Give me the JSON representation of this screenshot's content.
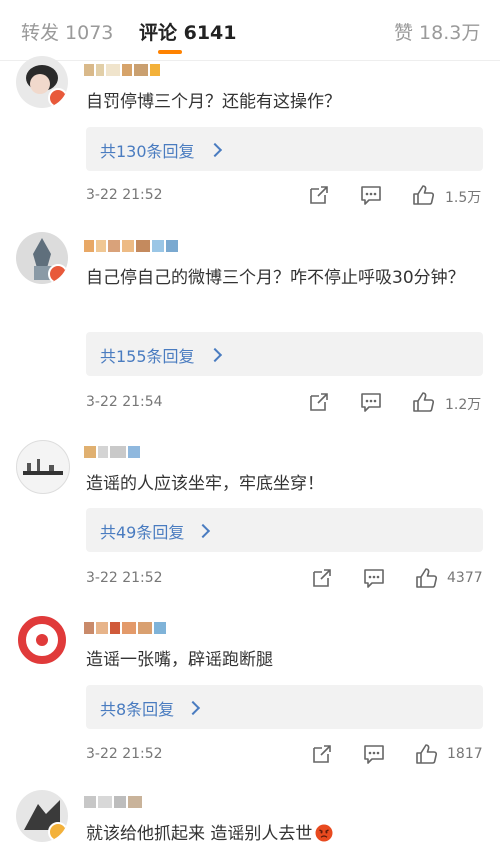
{
  "tabs": {
    "repost": "转发 1073",
    "comments": "评论 6141",
    "likes": "赞 18.3万"
  },
  "comments": [
    {
      "text": "自罚停博三个月？还能有这操作？",
      "replies": "共130条回复",
      "time": "3-22 21:52",
      "likes": "1.5万"
    },
    {
      "text": "自己停自己的微博三个月？咋不停止呼吸30分钟？",
      "replies": "共155条回复",
      "time": "3-22 21:54",
      "likes": "1.2万"
    },
    {
      "text": "造谣的人应该坐牢，牢底坐穿！",
      "replies": "共49条回复",
      "time": "3-22 21:52",
      "likes": "4377"
    },
    {
      "text": "造谣一张嘴，辟谣跑断腿",
      "replies": "共8条回复",
      "time": "3-22 21:52",
      "likes": "1817"
    },
    {
      "text": "就该给他抓起来 造谣别人去世"
    }
  ],
  "colors": {
    "accent": "#ff8200",
    "link": "#4a7cc0",
    "badge": "#e8593a"
  },
  "icons": [
    "share-icon",
    "comment-icon",
    "like-icon",
    "angry-emoji-icon",
    "verified-badge-icon"
  ]
}
